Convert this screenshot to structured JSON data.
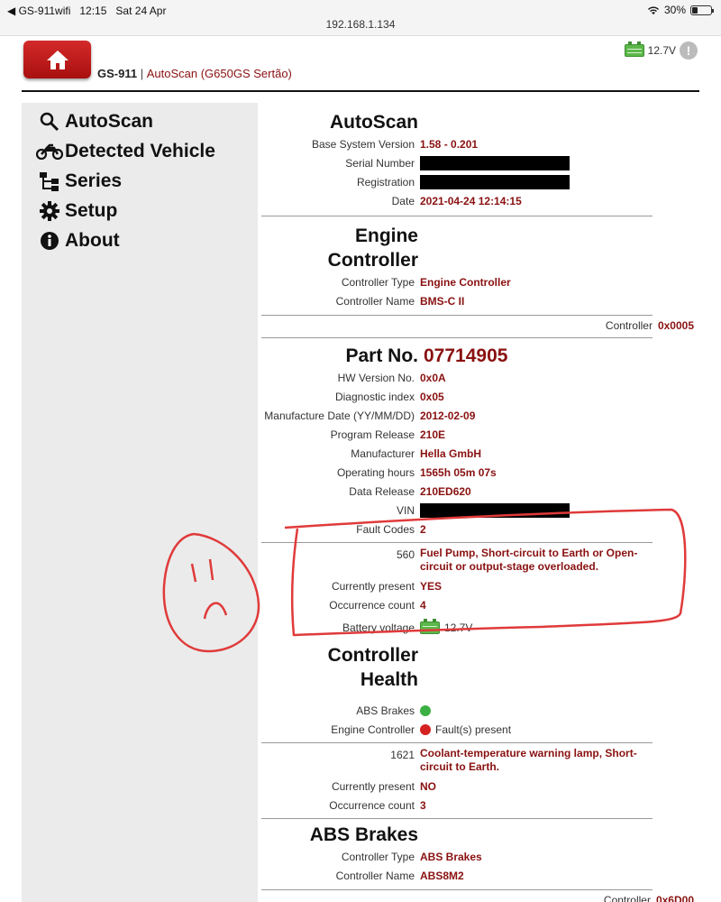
{
  "statusbar": {
    "carrier": "◀ GS-911wifi",
    "time": "12:15",
    "date": "Sat 24 Apr",
    "url": "192.168.1.134",
    "battery": "30%"
  },
  "header": {
    "brand": "GS-911",
    "separator": "|",
    "subtitle": "AutoScan (G650GS Sertão)",
    "voltage": "12.7V",
    "info_glyph": "!"
  },
  "sidebar": {
    "items": [
      {
        "label": "AutoScan",
        "icon": "search-icon"
      },
      {
        "label": "Detected Vehicle",
        "icon": "motorcycle-icon"
      },
      {
        "label": "Series",
        "icon": "sitemap-icon"
      },
      {
        "label": "Setup",
        "icon": "gear-icon"
      },
      {
        "label": "About",
        "icon": "info-icon"
      }
    ]
  },
  "autoscan": {
    "title": "AutoScan",
    "base_label": "Base System Version",
    "base_value": "1.58 - 0.201",
    "serial_label": "Serial Number",
    "registration_label": "Registration",
    "date_label": "Date",
    "date_value": "2021-04-24 12:14:15"
  },
  "engine": {
    "title_line1": "Engine",
    "title_line2": "Controller",
    "type_label": "Controller Type",
    "type_value": "Engine Controller",
    "name_label": "Controller Name",
    "name_value": "BMS-C II",
    "controller_label": "Controller",
    "controller_value": "0x0005"
  },
  "part": {
    "title": "Part No.",
    "number": "07714905",
    "fields": [
      {
        "label": "HW Version No.",
        "value": "0x0A"
      },
      {
        "label": "Diagnostic index",
        "value": "0x05"
      },
      {
        "label": "Manufacture Date (YY/MM/DD)",
        "value": "2012-02-09"
      },
      {
        "label": "Program Release",
        "value": "210E"
      },
      {
        "label": "Manufacturer",
        "value": "Hella GmbH"
      },
      {
        "label": "Operating hours",
        "value": "1565h 05m 07s"
      },
      {
        "label": "Data Release",
        "value": "210ED620"
      }
    ],
    "vin_label": "VIN",
    "fault_label": "Fault Codes",
    "fault_value": "2"
  },
  "fault1": {
    "code": "560",
    "description": "Fuel Pump, Short-circuit to Earth or Open-circuit or output-stage overloaded.",
    "present_label": "Currently present",
    "present_value": "YES",
    "count_label": "Occurrence count",
    "count_value": "4",
    "battery_label": "Battery voltage",
    "battery_value": "12.7V"
  },
  "health": {
    "title_line1": "Controller",
    "title_line2": "Health",
    "abs_label": "ABS Brakes",
    "abs_status_color": "#3cb043",
    "engine_label": "Engine Controller",
    "engine_status": "Fault(s) present",
    "engine_status_color": "#d42222"
  },
  "fault2": {
    "code": "1621",
    "description": "Coolant-temperature warning lamp, Short-circuit to Earth.",
    "present_label": "Currently present",
    "present_value": "NO",
    "count_label": "Occurrence count",
    "count_value": "3"
  },
  "abs": {
    "title": "ABS Brakes",
    "type_label": "Controller Type",
    "type_value": "ABS Brakes",
    "name_label": "Controller Name",
    "name_value": "ABS8M2",
    "controller_label": "Controller",
    "controller_value": "0x6D00"
  },
  "colors": {
    "accent_red": "#8a1111",
    "home_red": "#c11a1a",
    "annotation_red": "#e03a3a"
  }
}
